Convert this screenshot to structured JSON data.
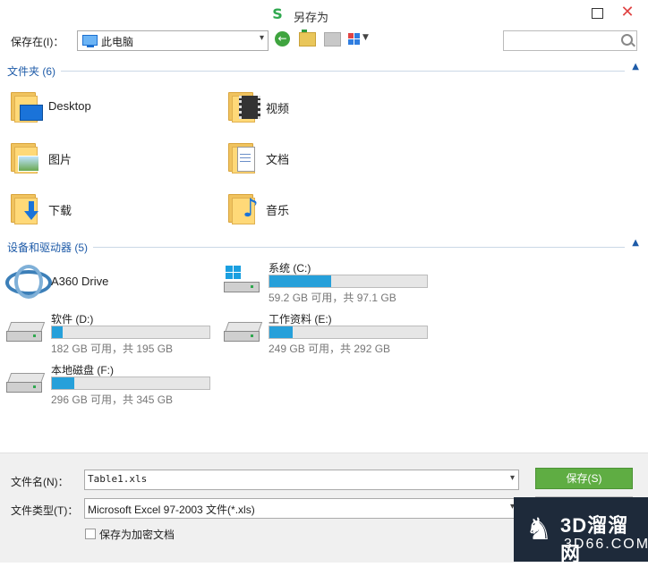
{
  "window": {
    "title": "另存为",
    "app_icon": "S"
  },
  "toolbar": {
    "save_in_label": "保存在(I)：",
    "location": "此电脑"
  },
  "groups": {
    "folders": {
      "title": "文件夹 (6)",
      "items": [
        {
          "label": "Desktop",
          "icon": "desktop-folder-icon"
        },
        {
          "label": "视频",
          "icon": "videos-folder-icon"
        },
        {
          "label": "图片",
          "icon": "pictures-folder-icon"
        },
        {
          "label": "文档",
          "icon": "documents-folder-icon"
        },
        {
          "label": "下载",
          "icon": "downloads-folder-icon"
        },
        {
          "label": "音乐",
          "icon": "music-folder-icon"
        }
      ]
    },
    "devices": {
      "title": "设备和驱动器 (5)",
      "a360": {
        "label": "A360 Drive"
      },
      "drives": [
        {
          "name": "系统 (C:)",
          "info": "59.2 GB 可用，共 97.1 GB",
          "used_fraction": 0.39
        },
        {
          "name": "软件 (D:)",
          "info": "182 GB 可用，共 195 GB",
          "used_fraction": 0.07
        },
        {
          "name": "工作资料 (E:)",
          "info": "249 GB 可用，共 292 GB",
          "used_fraction": 0.15
        },
        {
          "name": "本地磁盘 (F:)",
          "info": "296 GB 可用，共 345 GB",
          "used_fraction": 0.14
        }
      ]
    }
  },
  "footer": {
    "filename_label": "文件名(N)：",
    "filename_value": "Table1.xls",
    "filetype_label": "文件类型(T)：",
    "filetype_value": "Microsoft Excel 97-2003 文件(*.xls)",
    "save_button": "保存(S)",
    "encrypt_label": "保存为加密文档"
  },
  "watermark": {
    "brand": "3D溜溜网",
    "site": "3D66.COM"
  },
  "colors": {
    "accent_green": "#5fad43",
    "group_title": "#1e5ba8",
    "bar_fill": "#26a0da",
    "close": "#e04343"
  }
}
